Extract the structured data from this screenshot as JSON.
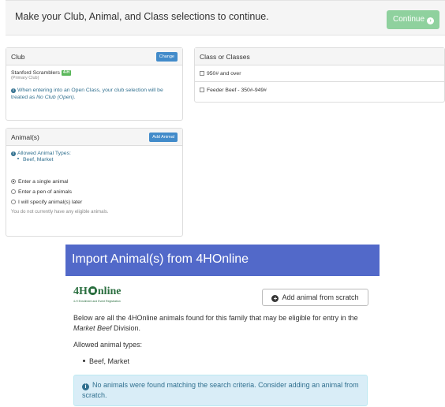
{
  "header": {
    "message": "Make your Club, Animal, and Class selections to continue.",
    "continue_label": "Continue",
    "continue_icon": "arrow-circle-right-icon",
    "continue_color": "#8fd19e"
  },
  "club_panel": {
    "title": "Club",
    "change_label": "Change",
    "club_name": "Stanford Scramblers",
    "club_badge": "4-H",
    "club_sub": "(Primary Club)",
    "info_prefix": "When entering into an Open Class, your club selection will be treated as ",
    "info_emphasis": "No Club (Open)",
    "info_suffix": "."
  },
  "class_panel": {
    "title": "Class or Classes",
    "options": [
      "950# and over",
      "Feeder Beef - 350#-949#"
    ]
  },
  "animals_panel": {
    "title": "Animal(s)",
    "add_label": "Add Animal",
    "allowed_title": "Allowed Animal Types:",
    "allowed_item": "Beef, Market",
    "radio_options": [
      "Enter a single animal",
      "Enter a pen of animals",
      "I will specify animal(s) later"
    ],
    "selected_index": 0,
    "no_animals_text": "You do not currently have any eligible animals."
  },
  "import_panel": {
    "title": "Import Animal(s) from 4HOnline",
    "logo_left": "4H",
    "logo_right": "nline",
    "logo_tag": "4-H Enrollment and Event Registration",
    "add_scratch_label": "Add animal from scratch",
    "desc_prefix": "Below are all the 4HOnline animals found for this family that may be eligible for entry in the ",
    "desc_emphasis": "Market Beef",
    "desc_suffix": " Division.",
    "allowed_label": "Allowed animal types:",
    "allowed_item": "Beef, Market",
    "alert_text": "No animals were found matching the search criteria. Consider adding an animal from scratch.",
    "header_color": "#5269c9"
  }
}
